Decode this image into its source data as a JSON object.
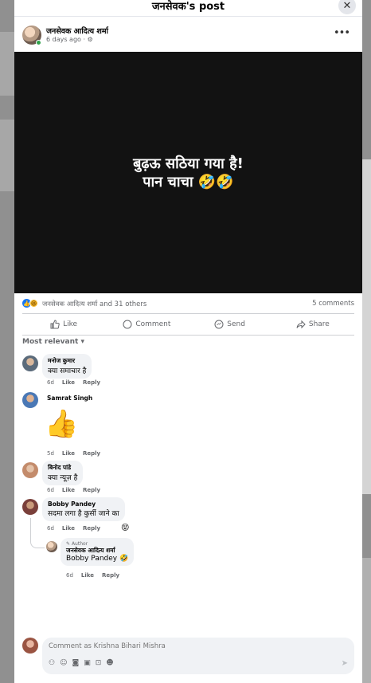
{
  "modal": {
    "title": "जनसेवक's post",
    "close_glyph": "✕"
  },
  "post": {
    "author_name": "जनसेवक आदित्य शर्मा",
    "time": "6 days ago",
    "privacy_glyph": "·  ⚙",
    "more_glyph": "•••",
    "image_text_line1": "बुढ़ऊ सठिया गया है!",
    "image_text_line2": "पान चाचा 🤣🤣"
  },
  "reactions": {
    "names": "जनसेवक आदित्य शर्मा and 31 others",
    "comments": "5 comments"
  },
  "actions": {
    "like": "Like",
    "comment": "Comment",
    "send": "Send",
    "share": "Share"
  },
  "sort_label": "Most relevant",
  "comments": [
    {
      "name": "मनोज कुमार",
      "text": "क्या समाचार है",
      "time": "6d",
      "like": "Like",
      "reply": "Reply"
    },
    {
      "name": "Samrat Singh",
      "text": "",
      "sticker": "👍",
      "time": "5d",
      "like": "Like",
      "reply": "Reply"
    },
    {
      "name": "बिनोद पांडे",
      "text": "क्या न्यूज़ है",
      "time": "6d",
      "like": "Like",
      "reply": "Reply"
    },
    {
      "name": "Bobby Pandey",
      "text": "सदमा लगा है कुर्सी जाने का",
      "time": "6d",
      "like": "Like",
      "reply": "Reply",
      "reaction": "😝"
    }
  ],
  "reply": {
    "tag": "Author",
    "name": "जनसेवक आदित्य शर्मा",
    "text": "Bobby Pandey 🤣",
    "time": "6d",
    "like": "Like",
    "reply": "Reply"
  },
  "compose": {
    "placeholder": "Comment as Krishna Bihari Mishra",
    "icons": [
      "sticker-icon",
      "emoji-icon",
      "gif-icon",
      "camera-icon",
      "gif2-icon",
      "sticker2-icon"
    ],
    "send_glyph": "➤"
  }
}
